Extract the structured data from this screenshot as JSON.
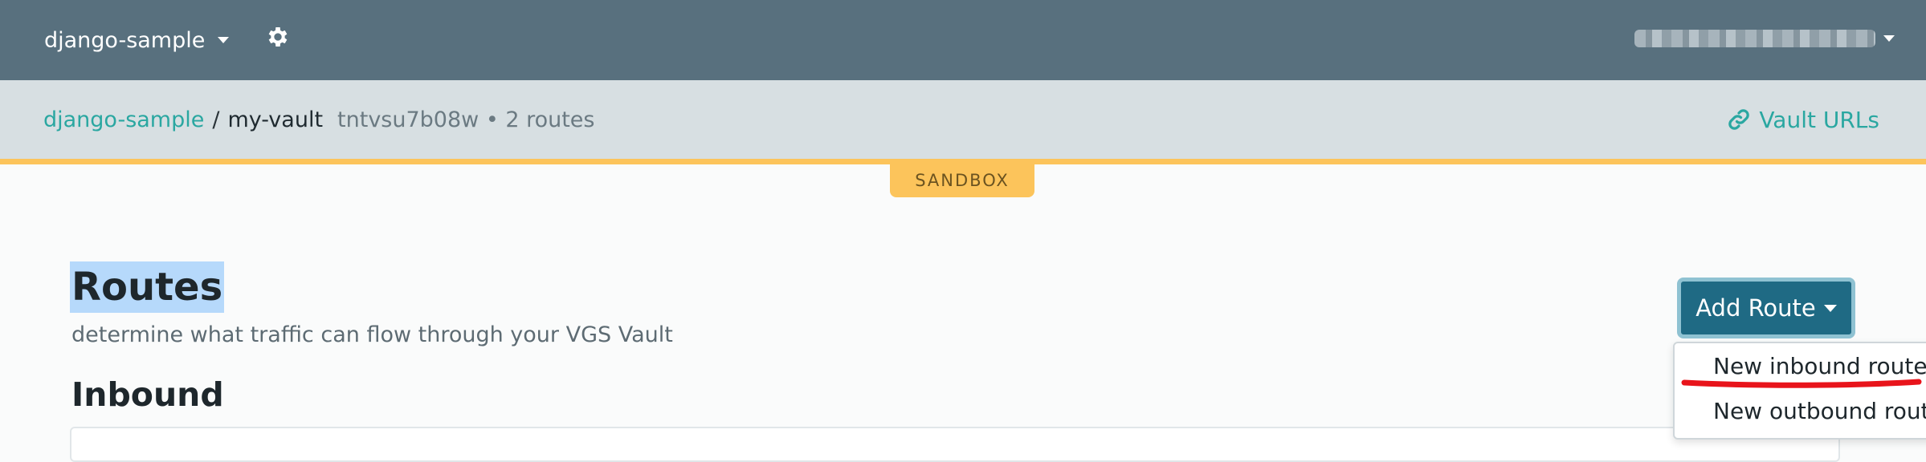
{
  "topbar": {
    "project_name": "django-sample",
    "icons": {
      "settings": "gear-icon",
      "project_caret": "caret-down-icon",
      "user_caret": "caret-down-icon"
    },
    "background": "#58707e"
  },
  "breadcrumb": {
    "organization": "django-sample",
    "separator": "/",
    "vault_name": "my-vault",
    "vault_meta": "tntvsu7b08w • 2 routes"
  },
  "vault_urls": {
    "label": "Vault URLs",
    "icon": "link-icon"
  },
  "environment_badge": "SANDBOX",
  "main": {
    "title": "Routes",
    "subtitle": "determine what traffic can flow through your VGS Vault",
    "section_title": "Inbound"
  },
  "add_route": {
    "label": "Add Route",
    "menu": [
      "New inbound route",
      "New outbound route"
    ]
  },
  "colors": {
    "accent": "#2aa7a1",
    "button": "#1f6a84",
    "badge": "#fcc45b",
    "annotation": "#e8141b"
  }
}
